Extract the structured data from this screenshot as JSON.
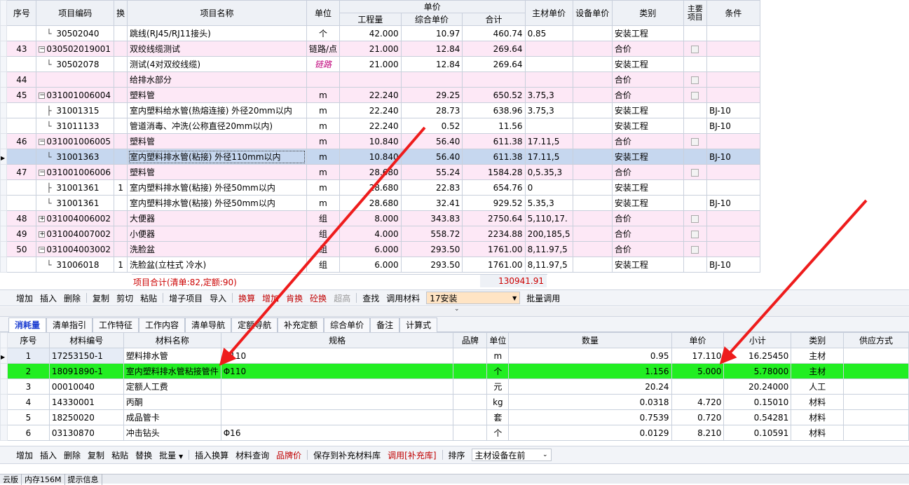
{
  "top_headers": {
    "seq": "序号",
    "code": "项目编码",
    "swap": "换",
    "name": "项目名称",
    "unit": "单位",
    "unit_price": "单价",
    "qty": "工程量",
    "comp_price": "综合单价",
    "total": "合计",
    "main_mat": "主材单价",
    "equip": "设备单价",
    "category": "类别",
    "main_item": "主要项目",
    "cond": "条件"
  },
  "top_rows": [
    {
      "seq": "",
      "code": "30502040",
      "swap": "",
      "name": "跳线(RJ45/RJ11接头)",
      "unit": "个",
      "qty": "42.000",
      "price": "10.97",
      "total": "460.74",
      "main": "0.85",
      "equip": "",
      "cat": "安装工程",
      "chk": false,
      "cond": "",
      "type": "child",
      "tree": "end"
    },
    {
      "seq": "43",
      "code": "030502019001",
      "swap": "",
      "name": "双绞线缆测试",
      "unit": "链路/点",
      "qty": "21.000",
      "price": "12.84",
      "total": "269.64",
      "main": "",
      "equip": "",
      "cat": "合价",
      "chk": true,
      "cond": "",
      "type": "parent",
      "tree": "minus"
    },
    {
      "seq": "",
      "code": "30502078",
      "swap": "",
      "name": "测试(4对双绞线缆)",
      "unit": "链路",
      "qty": "21.000",
      "price": "12.84",
      "total": "269.64",
      "main": "",
      "equip": "",
      "cat": "安装工程",
      "chk": false,
      "cond": "",
      "type": "child",
      "tree": "end",
      "unitlink": true
    },
    {
      "seq": "44",
      "code": "",
      "swap": "",
      "name": "给排水部分",
      "unit": "",
      "qty": "",
      "price": "",
      "total": "",
      "main": "",
      "equip": "",
      "cat": "合价",
      "chk": true,
      "cond": "",
      "type": "parent",
      "tree": "none"
    },
    {
      "seq": "45",
      "code": "031001006004",
      "swap": "",
      "name": "塑料管",
      "unit": "m",
      "qty": "22.240",
      "price": "29.25",
      "total": "650.52",
      "main": "3.75,3",
      "equip": "",
      "cat": "合价",
      "chk": true,
      "cond": "",
      "type": "parent",
      "tree": "minus"
    },
    {
      "seq": "",
      "code": "31001315",
      "swap": "",
      "name": "室内塑料给水管(热熔连接) 外径20mm以内",
      "unit": "m",
      "qty": "22.240",
      "price": "28.73",
      "total": "638.96",
      "main": "3.75,3",
      "equip": "",
      "cat": "安装工程",
      "chk": false,
      "cond": "BJ-10",
      "type": "child",
      "tree": "mid"
    },
    {
      "seq": "",
      "code": "31011133",
      "swap": "",
      "name": "管道消毒、冲洗(公称直径20mm以内)",
      "unit": "m",
      "qty": "22.240",
      "price": "0.52",
      "total": "11.56",
      "main": "",
      "equip": "",
      "cat": "安装工程",
      "chk": false,
      "cond": "BJ-10",
      "type": "child",
      "tree": "end"
    },
    {
      "seq": "46",
      "code": "031001006005",
      "swap": "",
      "name": "塑料管",
      "unit": "m",
      "qty": "10.840",
      "price": "56.40",
      "total": "611.38",
      "main": "17.11,5",
      "equip": "",
      "cat": "合价",
      "chk": true,
      "cond": "",
      "type": "parent",
      "tree": "minus"
    },
    {
      "seq": "",
      "code": "31001363",
      "swap": "",
      "name": "室内塑料排水管(粘接) 外径110mm以内",
      "unit": "m",
      "qty": "10.840",
      "price": "56.40",
      "total": "611.38",
      "main": "17.11,5",
      "equip": "",
      "cat": "安装工程",
      "chk": false,
      "cond": "BJ-10",
      "type": "selected",
      "tree": "end"
    },
    {
      "seq": "47",
      "code": "031001006006",
      "swap": "",
      "name": "塑料管",
      "unit": "m",
      "qty": "28.680",
      "price": "55.24",
      "total": "1584.28",
      "main": "0,5.35,3",
      "equip": "",
      "cat": "合价",
      "chk": true,
      "cond": "",
      "type": "parent",
      "tree": "minus"
    },
    {
      "seq": "",
      "code": "31001361",
      "swap": "1",
      "name": "室内塑料排水管(粘接) 外径50mm以内",
      "unit": "m",
      "qty": "28.680",
      "price": "22.83",
      "total": "654.76",
      "main": "0",
      "equip": "",
      "cat": "安装工程",
      "chk": false,
      "cond": "",
      "type": "child",
      "tree": "mid"
    },
    {
      "seq": "",
      "code": "31001361",
      "swap": "",
      "name": "室内塑料排水管(粘接) 外径50mm以内",
      "unit": "m",
      "qty": "28.680",
      "price": "32.41",
      "total": "929.52",
      "main": "5.35,3",
      "equip": "",
      "cat": "安装工程",
      "chk": false,
      "cond": "BJ-10",
      "type": "child",
      "tree": "end"
    },
    {
      "seq": "48",
      "code": "031004006002",
      "swap": "",
      "name": "大便器",
      "unit": "组",
      "qty": "8.000",
      "price": "343.83",
      "total": "2750.64",
      "main": "5,110,17.",
      "equip": "",
      "cat": "合价",
      "chk": true,
      "cond": "",
      "type": "parent",
      "tree": "plus"
    },
    {
      "seq": "49",
      "code": "031004007002",
      "swap": "",
      "name": "小便器",
      "unit": "组",
      "qty": "4.000",
      "price": "558.72",
      "total": "2234.88",
      "main": "200,185,5",
      "equip": "",
      "cat": "合价",
      "chk": true,
      "cond": "",
      "type": "parent",
      "tree": "plus"
    },
    {
      "seq": "50",
      "code": "031004003002",
      "swap": "",
      "name": "洗脸盆",
      "unit": "组",
      "qty": "6.000",
      "price": "293.50",
      "total": "1761.00",
      "main": "8,11.97,5",
      "equip": "",
      "cat": "合价",
      "chk": true,
      "cond": "",
      "type": "parent",
      "tree": "minus"
    },
    {
      "seq": "",
      "code": "31006018",
      "swap": "1",
      "name": "洗脸盆(立柱式 冷水)",
      "unit": "组",
      "qty": "6.000",
      "price": "293.50",
      "total": "1761.00",
      "main": "8,11.97,5",
      "equip": "",
      "cat": "安装工程",
      "chk": false,
      "cond": "BJ-10",
      "type": "child",
      "tree": "end"
    }
  ],
  "summary": {
    "label": "项目合计(清单:82,定额:90)",
    "total": "130941.91"
  },
  "toolbar1": {
    "items": [
      "增加",
      "插入",
      "删除",
      "复制",
      "剪切",
      "粘贴",
      "增子项目",
      "导入"
    ],
    "red_items": [
      "换算",
      "增加",
      "肯换",
      "砼换"
    ],
    "gray_item": "超高",
    "items2": [
      "查找",
      "调用材料"
    ],
    "combo_value": "17安装",
    "batch": "批量调用"
  },
  "tabs": [
    "消耗量",
    "清单指引",
    "工作特征",
    "工作内容",
    "清单导航",
    "定额导航",
    "补充定额",
    "综合单价",
    "备注",
    "计算式"
  ],
  "bottom_headers": {
    "seq": "序号",
    "code": "材料编号",
    "name": "材料名称",
    "spec": "规格",
    "brand": "品牌",
    "unit": "单位",
    "qty": "数量",
    "price": "单价",
    "subtotal": "小计",
    "cat": "类别",
    "supply": "供应方式"
  },
  "bottom_rows": [
    {
      "seq": "1",
      "code": "17253150-1",
      "name": "塑料排水管",
      "spec": "Φ110",
      "brand": "",
      "unit": "m",
      "qty": "0.95",
      "price": "17.110",
      "subtotal": "16.25450",
      "cat": "主材",
      "supply": "",
      "type": "current"
    },
    {
      "seq": "2",
      "code": "18091890-1",
      "name": "室内塑料排水管粘接管件",
      "spec": "Φ110",
      "brand": "",
      "unit": "个",
      "qty": "1.156",
      "price": "5.000",
      "subtotal": "5.78000",
      "cat": "主材",
      "supply": "",
      "type": "green"
    },
    {
      "seq": "3",
      "code": "00010040",
      "name": "定额人工费",
      "spec": "",
      "brand": "",
      "unit": "元",
      "qty": "20.24",
      "price": "",
      "subtotal": "20.24000",
      "cat": "人工",
      "supply": "",
      "type": ""
    },
    {
      "seq": "4",
      "code": "14330001",
      "name": "丙酮",
      "spec": "",
      "brand": "",
      "unit": "kg",
      "qty": "0.0318",
      "price": "4.720",
      "subtotal": "0.15010",
      "cat": "材料",
      "supply": "",
      "type": ""
    },
    {
      "seq": "5",
      "code": "18250020",
      "name": "成品管卡",
      "spec": "",
      "brand": "",
      "unit": "套",
      "qty": "0.7539",
      "price": "0.720",
      "subtotal": "0.54281",
      "cat": "材料",
      "supply": "",
      "type": ""
    },
    {
      "seq": "6",
      "code": "03130870",
      "name": "冲击钻头",
      "spec": "Φ16",
      "brand": "",
      "unit": "个",
      "qty": "0.0129",
      "price": "8.210",
      "subtotal": "0.10591",
      "cat": "材料",
      "supply": "",
      "type": ""
    }
  ],
  "toolbar2": {
    "items": [
      "增加",
      "插入",
      "删除",
      "复制",
      "粘贴",
      "替换"
    ],
    "batch": "批量",
    "items2": [
      "插入换算",
      "材料查询"
    ],
    "red1": "品牌价",
    "save": "保存到补充材料库",
    "red2": "调用[补充库]",
    "sort": "排序",
    "combo_value": "主材设备在前"
  },
  "status": {
    "a": "云版",
    "b": "内存156M",
    "c": "提示信息"
  },
  "colors": {
    "pink": "#fde8f6",
    "selected": "#c6d7ef",
    "green": "#22ee22",
    "arrow": "#ee1c1c"
  }
}
